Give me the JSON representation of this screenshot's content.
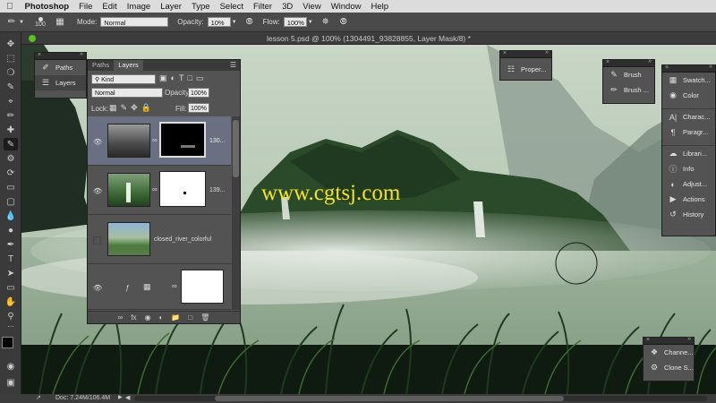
{
  "menu": {
    "app": "Photoshop",
    "items": [
      "File",
      "Edit",
      "Image",
      "Layer",
      "Type",
      "Select",
      "Filter",
      "3D",
      "View",
      "Window",
      "Help"
    ]
  },
  "options": {
    "brush_size": "100",
    "mode_label": "Mode:",
    "mode_value": "Normal",
    "opacity_label": "Opacity:",
    "opacity_value": "10%",
    "flow_label": "Flow:",
    "flow_value": "100%"
  },
  "document": {
    "tab_title": "lesson 5.psd @ 100% (1304491_93828855, Layer Mask/8) *"
  },
  "watermark": "www.cgtsj.com",
  "status": {
    "doc_size": "Doc: 7.24M/106.4M"
  },
  "left_dock": {
    "items": [
      "Paths",
      "Layers"
    ]
  },
  "layers_panel": {
    "tabs": [
      "Paths",
      "Layers"
    ],
    "filter_kind": "Kind",
    "blend_mode": "Normal",
    "opacity_label": "Opacity:",
    "opacity_value": "100%",
    "lock_label": "Lock:",
    "fill_label": "Fill:",
    "fill_value": "100%",
    "layers": [
      {
        "name": "130...",
        "visible": true,
        "selected": true
      },
      {
        "name": "139...",
        "visible": true,
        "selected": false
      },
      {
        "name": "closed_river_colorful",
        "visible": false,
        "selected": false
      },
      {
        "name": "",
        "visible": true,
        "selected": false
      }
    ],
    "footer_fx": "fx"
  },
  "properties_dock": {
    "items": [
      "Proper..."
    ]
  },
  "brush_dock": {
    "items": [
      "Brush",
      "Brush ..."
    ]
  },
  "right_dock": {
    "items": [
      "Swatch...",
      "Color",
      "Charac...",
      "Paragr...",
      "Librari...",
      "Info",
      "Adjust...",
      "Actions",
      "History"
    ]
  },
  "bottom_dock": {
    "items": [
      "Channe...",
      "Clone S..."
    ]
  },
  "colors": {
    "ui_dark": "#2b2b2b",
    "panel": "#535353",
    "watermark": "#f5e418",
    "selected_layer": "#6a6f82"
  }
}
